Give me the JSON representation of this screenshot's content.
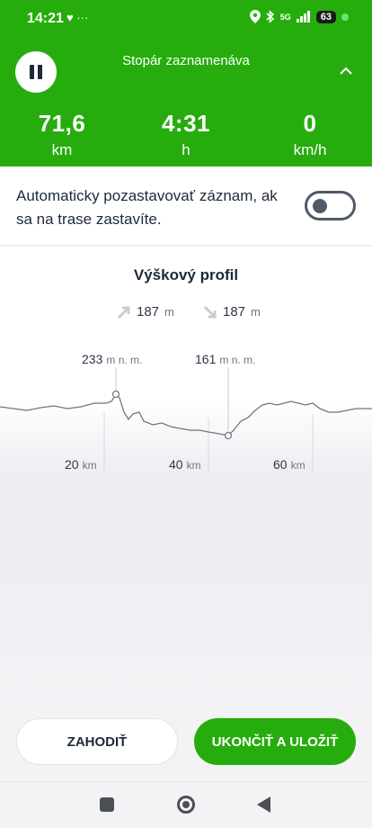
{
  "status_bar": {
    "time": "14:21",
    "left_icons": "♥ ···",
    "net": "5G",
    "battery": "63"
  },
  "header": {
    "title": "Stopár zaznamenáva",
    "stats": [
      {
        "value": "71,6",
        "unit": "km"
      },
      {
        "value": "4:31",
        "unit": "h"
      },
      {
        "value": "0",
        "unit": "km/h"
      }
    ],
    "accent": "#26ad0d"
  },
  "auto_pause": {
    "text": "Automaticky pozastavovať záznam, ak sa na trase zastavíte.",
    "enabled": false
  },
  "profile": {
    "title": "Výškový profil",
    "ascent": {
      "value": "187",
      "unit": "m"
    },
    "descent": {
      "value": "187",
      "unit": "m"
    },
    "max": {
      "value": "233",
      "unit": "m n. m."
    },
    "min": {
      "value": "161",
      "unit": "m n. m."
    },
    "distance_ticks": [
      {
        "value": "20",
        "unit": "km"
      },
      {
        "value": "40",
        "unit": "km"
      },
      {
        "value": "60",
        "unit": "km"
      }
    ]
  },
  "actions": {
    "discard": "ZAHODIŤ",
    "save": "UKONČIŤ A ULOŽIŤ"
  },
  "icons": [
    "pause-icon",
    "chevron-up-icon",
    "ascent-arrow-icon",
    "descent-arrow-icon",
    "nav-recents-icon",
    "nav-home-icon",
    "nav-back-icon"
  ]
}
